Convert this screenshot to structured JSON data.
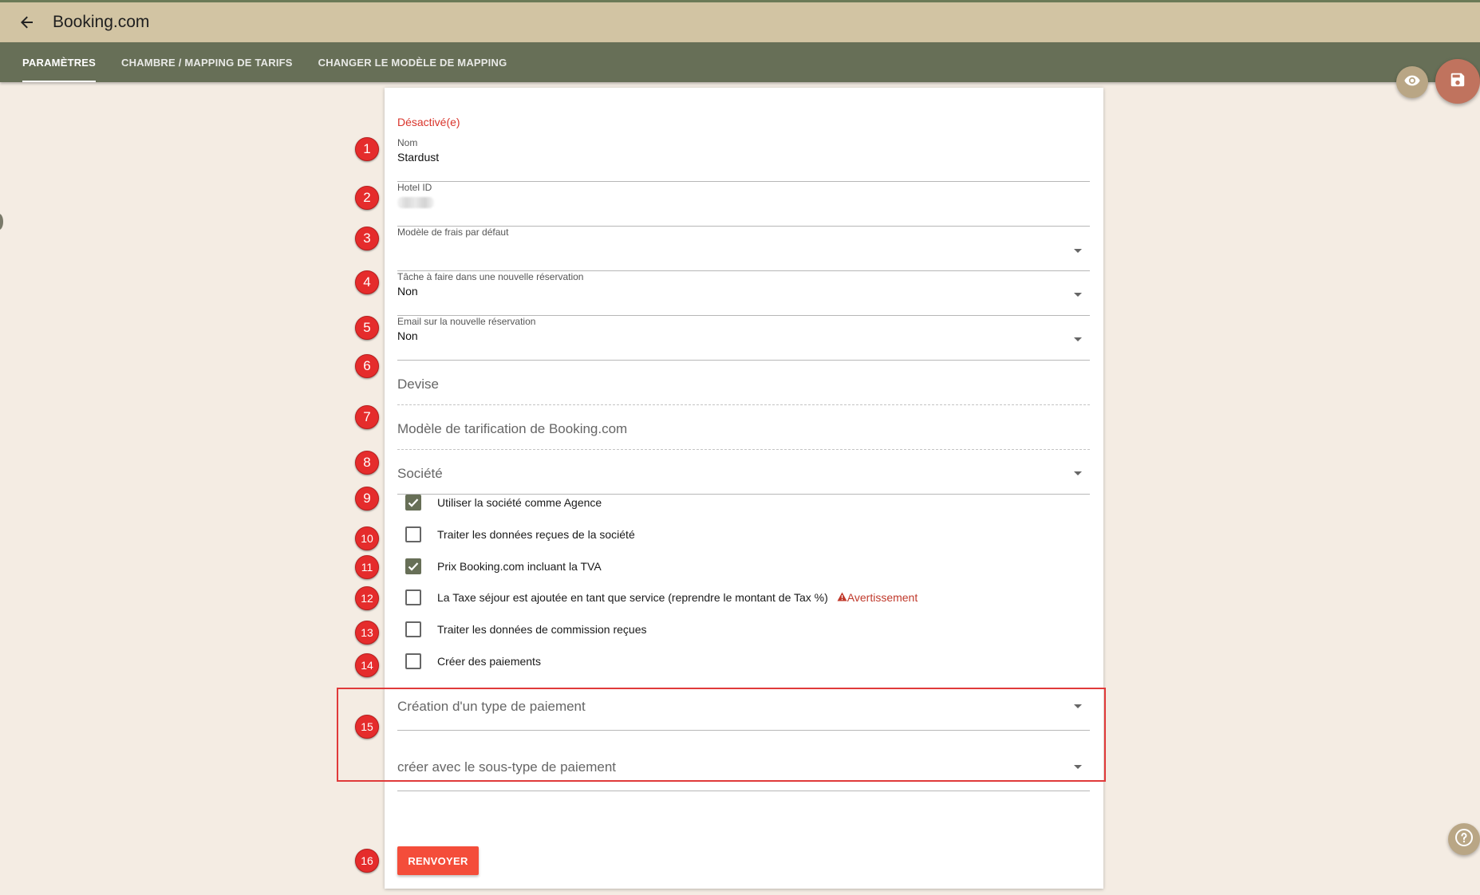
{
  "header": {
    "title": "Booking.com",
    "back_icon": "arrow-left-icon"
  },
  "tabs": [
    {
      "label": "PARAMÈTRES",
      "active": true
    },
    {
      "label": "CHAMBRE / MAPPING DE TARIFS",
      "active": false
    },
    {
      "label": "CHANGER LE MODÈLE DE MAPPING",
      "active": false
    }
  ],
  "form": {
    "status": "Désactivé(e)",
    "nom": {
      "label": "Nom",
      "value": "Stardust"
    },
    "hotel_id": {
      "label": "Hotel ID",
      "value": ""
    },
    "modele_frais": {
      "label": "Modèle de frais par défaut",
      "value": ""
    },
    "tache": {
      "label": "Tâche à faire dans une nouvelle réservation",
      "value": "Non"
    },
    "email": {
      "label": "Email sur la nouvelle réservation",
      "value": "Non"
    },
    "devise": {
      "placeholder": "Devise"
    },
    "modele_tarification": {
      "placeholder": "Modèle de tarification de Booking.com"
    },
    "societe": {
      "placeholder": "Société"
    },
    "checkboxes": [
      {
        "label": "Utiliser la société comme Agence",
        "checked": true
      },
      {
        "label": "Traiter les données reçues de la société",
        "checked": false
      },
      {
        "label": "Prix Booking.com incluant la TVA",
        "checked": true
      },
      {
        "label": "La Taxe séjour est ajoutée en tant que service (reprendre le montant de Tax %)",
        "checked": false
      },
      {
        "label": "Traiter les données de commission reçues",
        "checked": false
      },
      {
        "label": "Créer des paiements",
        "checked": false
      }
    ],
    "warning": "Avertissement",
    "type_paiement": {
      "placeholder": "Création d'un type de paiement"
    },
    "sous_type_paiement": {
      "placeholder": "créer avec le sous-type de paiement"
    },
    "submit_label": "RENVOYER"
  },
  "markers": [
    "1",
    "2",
    "3",
    "4",
    "5",
    "6",
    "7",
    "8",
    "9",
    "10",
    "11",
    "12",
    "13",
    "14",
    "15",
    "16"
  ],
  "colors": {
    "header_bg": "#d2c4a3",
    "tab_bg": "#676f57",
    "page_bg": "#f4ece3",
    "accent_red": "#f44d3a",
    "save_fab": "#c0735e",
    "marker_red": "#e52c2c"
  }
}
